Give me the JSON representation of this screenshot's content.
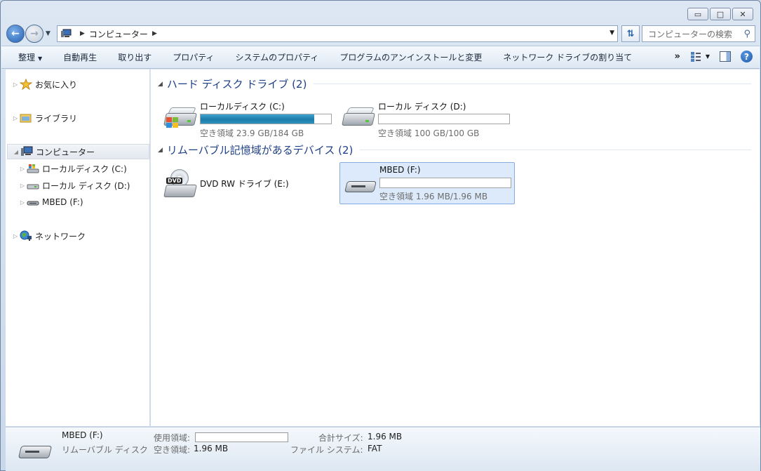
{
  "window": {
    "caption_buttons": {
      "minimize": "▭",
      "maximize": "□",
      "close": "✕"
    }
  },
  "address": {
    "crumb": "コンピューター",
    "search_placeholder": "コンピューターの検索"
  },
  "toolbar": {
    "items": [
      "整理",
      "自動再生",
      "取り出す",
      "プロパティ",
      "システムのプロパティ",
      "プログラムのアンインストールと変更",
      "ネットワーク ドライブの割り当て"
    ],
    "overflow": "»"
  },
  "nav": {
    "favorites": "お気に入り",
    "libraries": "ライブラリ",
    "computer": "コンピューター",
    "drive_c": "ローカルディスク (C:)",
    "drive_d": "ローカル ディスク (D:)",
    "drive_f": "MBED (F:)",
    "network": "ネットワーク"
  },
  "groups": {
    "hdd": "ハード ディスク ドライブ (2)",
    "removable": "リムーバブル記憶域があるデバイス (2)"
  },
  "drives": {
    "c": {
      "name": "ローカルディスク (C:)",
      "free": "空き領域 23.9 GB/184 GB",
      "used_fraction": 0.87
    },
    "d": {
      "name": "ローカル ディスク (D:)",
      "free": "空き領域 100 GB/100 GB",
      "used_fraction": 0.0
    },
    "e": {
      "name": "DVD RW ドライブ (E:)",
      "badge": "DVD"
    },
    "f": {
      "name": "MBED (F:)",
      "free": "空き領域 1.96 MB/1.96 MB",
      "used_fraction": 0.0
    }
  },
  "details": {
    "name": "MBED (F:)",
    "type": "リムーバブル ディスク",
    "used_label": "使用領域:",
    "free_label": "空き領域:",
    "free_value": "1.96 MB",
    "total_label": "合計サイズ:",
    "total_value": "1.96 MB",
    "fs_label": "ファイル システム:",
    "fs_value": "FAT"
  },
  "colors": {
    "group_header": "#1e3f86",
    "usage_bar": "#1c7aa9",
    "selection": "#dceafb"
  }
}
